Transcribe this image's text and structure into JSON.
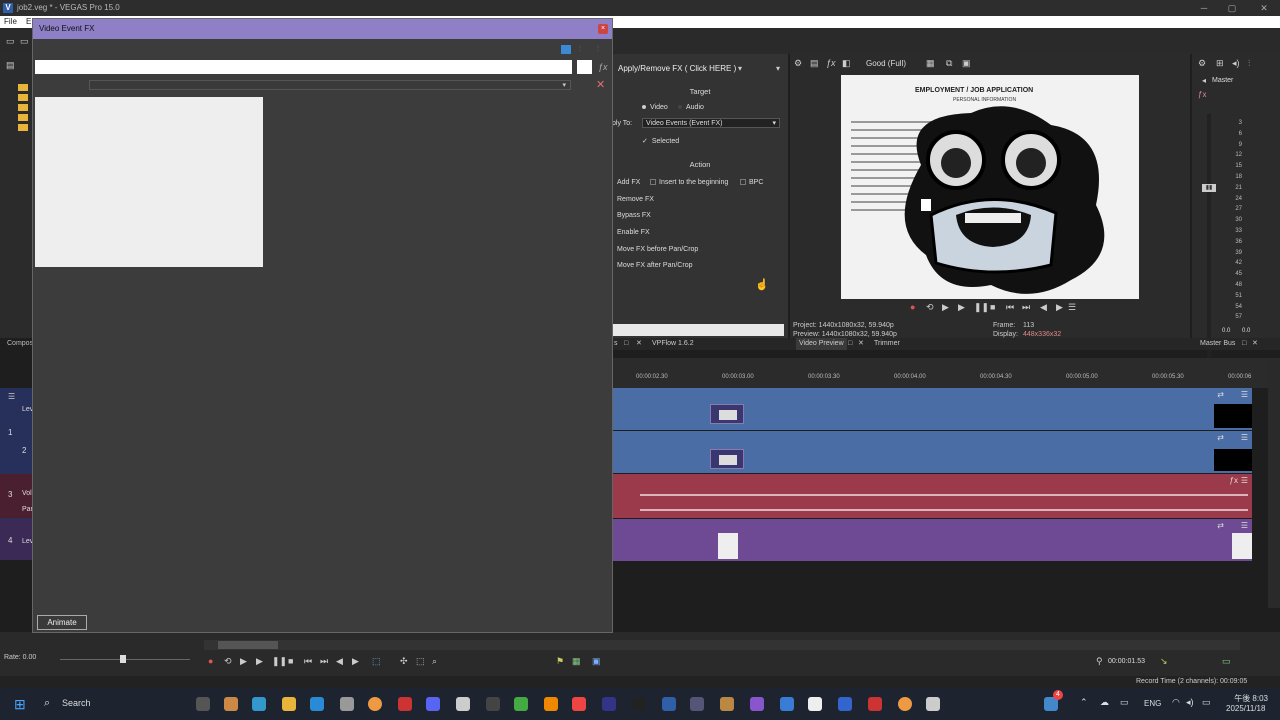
{
  "app": {
    "title": "job2.veg * - VEGAS Pro 15.0",
    "logo_letter": "V"
  },
  "menu": {
    "file": "File",
    "edit": "E"
  },
  "left_panel": {
    "compos_label": "Compos"
  },
  "dialog": {
    "title": "Video Event FX",
    "close_label": "×",
    "animate_label": "Animate"
  },
  "fx_panel": {
    "header": "Apply/Remove FX ( Click HERE )",
    "target_label": "Target",
    "video_label": "Video",
    "audio_label": "Audio",
    "apply_to_label": "ply To:",
    "apply_to_value": "Video Events (Event FX)",
    "selected_label": "Selected",
    "action_label": "Action",
    "add_fx": "Add FX",
    "insert_beginning": "Insert to the beginning",
    "bpc": "BPC",
    "remove_fx": "Remove FX",
    "bypass_fx": "Bypass FX",
    "enable_fx": "Enable FX",
    "move_before": "Move FX before Pan/Crop",
    "move_after": "Move FX after Pan/Crop"
  },
  "preview": {
    "quality": "Good (Full)",
    "project_info": "Project:   1440x1080x32, 59.940p",
    "preview_info": "Preview:  1440x1080x32, 59.940p",
    "frame_label": "Frame:",
    "frame_value": "113",
    "display_label": "Display:",
    "display_value": "448x336x32",
    "doc_heading": "EMPLOYMENT / JOB APPLICATION",
    "doc_sub": "PERSONAL INFORMATION"
  },
  "master": {
    "label": "Master",
    "scale": [
      "3",
      "6",
      "9",
      "12",
      "15",
      "18",
      "21",
      "24",
      "27",
      "30",
      "33",
      "36",
      "39",
      "42",
      "45",
      "48",
      "51",
      "54",
      "57"
    ],
    "level_left": "0.0",
    "level_right": "0.0"
  },
  "tabs": {
    "s_close": "s",
    "vpflow": "VPFlow 1.6.2",
    "video_preview": "Video Preview",
    "trimmer": "Trimmer",
    "master_bus": "Master Bus"
  },
  "ruler": [
    "00:00:02.30",
    "00:00:03.00",
    "00:00:03.30",
    "00:00:04.00",
    "00:00:04.30",
    "00:00:05.00",
    "00:00:05.30",
    "00:00:06"
  ],
  "track_headers": {
    "t1_num": "1",
    "t1_label": "Lev",
    "t2_num": "2",
    "t3_num": "3",
    "t3_vol": "Vol",
    "t3_pan": "Pan",
    "t4_num": "4",
    "t4_label": "Lev"
  },
  "transport": {
    "rate": "Rate: 0.00",
    "timecode": "00:00:01.53"
  },
  "status": {
    "record_time": "Record Time (2 channels): 00:09:05"
  },
  "taskbar": {
    "search": "Search",
    "language": "ENG",
    "time": "午後 8:03",
    "date": "2025/11/18",
    "notification_count": "4"
  },
  "colors": {
    "accent": "#8e7fc7",
    "video_track": "#4a6da5",
    "audio_track": "#9a3a4a"
  }
}
